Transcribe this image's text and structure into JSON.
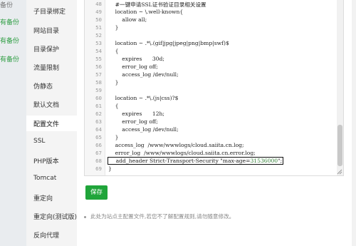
{
  "left_strip": {
    "rows": [
      {
        "text": "备份"
      },
      {
        "text": "有备份"
      },
      {
        "text": "有备份"
      },
      {
        "text": "有备份"
      }
    ]
  },
  "nav": {
    "items": [
      {
        "label": "子目录绑定"
      },
      {
        "label": "网站目录"
      },
      {
        "label": "目录保护"
      },
      {
        "label": "流量限制"
      },
      {
        "label": "伪静态"
      },
      {
        "label": "默认文档"
      },
      {
        "label": "配置文件"
      },
      {
        "label": "SSL"
      },
      {
        "label": "PHP版本"
      },
      {
        "label": "Tomcat"
      },
      {
        "label": "重定向"
      },
      {
        "label": "重定向(测试版)"
      },
      {
        "label": "反向代理"
      }
    ],
    "active": "配置文件"
  },
  "editor": {
    "lines": [
      {
        "n": "48",
        "text": "    #一键申请SSL证书验证目录相关设置"
      },
      {
        "n": "49",
        "text": "    location ~ \\.well-known{"
      },
      {
        "n": "50",
        "text": "        allow all;"
      },
      {
        "n": "51",
        "text": "    }"
      },
      {
        "n": "52",
        "text": ""
      },
      {
        "n": "53",
        "text": "    location ~ .*\\.(gif|jpg|jpeg|png|bmp|swf)$"
      },
      {
        "n": "54",
        "text": "    {"
      },
      {
        "n": "55",
        "text": "        expires      30d;"
      },
      {
        "n": "56",
        "text": "        error_log off;"
      },
      {
        "n": "57",
        "text": "        access_log /dev/null;"
      },
      {
        "n": "58",
        "text": "    }"
      },
      {
        "n": "59",
        "text": ""
      },
      {
        "n": "60",
        "text": "    location ~ .*\\.(js|css)?$"
      },
      {
        "n": "61",
        "text": "    {"
      },
      {
        "n": "62",
        "text": "        expires      12h;"
      },
      {
        "n": "63",
        "text": "        error_log off;"
      },
      {
        "n": "64",
        "text": "        access_log /dev/null;"
      },
      {
        "n": "65",
        "text": "    }"
      },
      {
        "n": "66",
        "text": "    access_log  /www/wwwlogs/cloud.saiita.cn.log;"
      },
      {
        "n": "67",
        "text": "    error_log  /www/wwwlogs/cloud.saiita.cn.error.log;"
      },
      {
        "n": "68",
        "pre": "    add_header Strict-Transport-Security \"max-age=",
        "num": "31536000",
        "post": "\";"
      },
      {
        "n": "69",
        "text": "}"
      }
    ]
  },
  "save_label": "保存",
  "note": "此处为站点主配置文件,若您不了解配置规则,请勿随意修改。",
  "colors": {
    "accent_green": "#20a53a",
    "highlight_border": "#111111"
  }
}
